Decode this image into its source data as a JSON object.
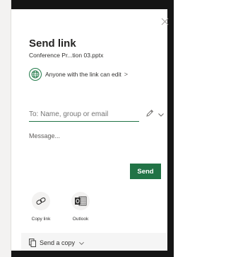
{
  "dialog": {
    "title": "Send link",
    "filename": "Conference Pr...tion 03.pptx",
    "permission": "Anyone with the link can edit",
    "permission_chevron": ">",
    "to_placeholder": "To: Name, group or email",
    "message_placeholder": "Message...",
    "send_label": "Send"
  },
  "share_options": [
    {
      "label": "Copy link",
      "icon": "link-icon"
    },
    {
      "label": "Outlook",
      "icon": "outlook-icon"
    }
  ],
  "footer": {
    "send_copy_label": "Send a copy"
  },
  "colors": {
    "accent": "#217346",
    "frame": "#151515",
    "sidebar": "#f3f2f1",
    "footer_bg": "#f5f5f5"
  }
}
